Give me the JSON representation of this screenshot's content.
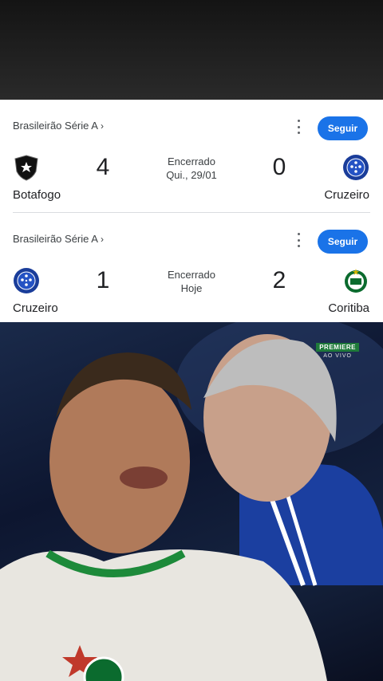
{
  "matches": [
    {
      "league": "Brasileirão Série A",
      "league_chevron": "›",
      "follow_label": "Seguir",
      "home": {
        "name": "Botafogo",
        "score": "4",
        "crest_icon": "botafogo-crest-icon"
      },
      "away": {
        "name": "Cruzeiro",
        "score": "0",
        "crest_icon": "cruzeiro-crest-icon"
      },
      "status": "Encerrado",
      "date": "Qui., 29/01"
    },
    {
      "league": "Brasileirão Série A",
      "league_chevron": "›",
      "follow_label": "Seguir",
      "home": {
        "name": "Cruzeiro",
        "score": "1",
        "crest_icon": "cruzeiro-crest-icon"
      },
      "away": {
        "name": "Coritiba",
        "score": "2",
        "crest_icon": "coritiba-crest-icon"
      },
      "status": "Encerrado",
      "date": "Hoje"
    }
  ],
  "broadcast": {
    "brand": "PREMIERE",
    "live": "AO VIVO"
  },
  "colors": {
    "accent": "#1a73e8",
    "card_bg": "#ffffff",
    "top_band": "#1e1e1e"
  }
}
